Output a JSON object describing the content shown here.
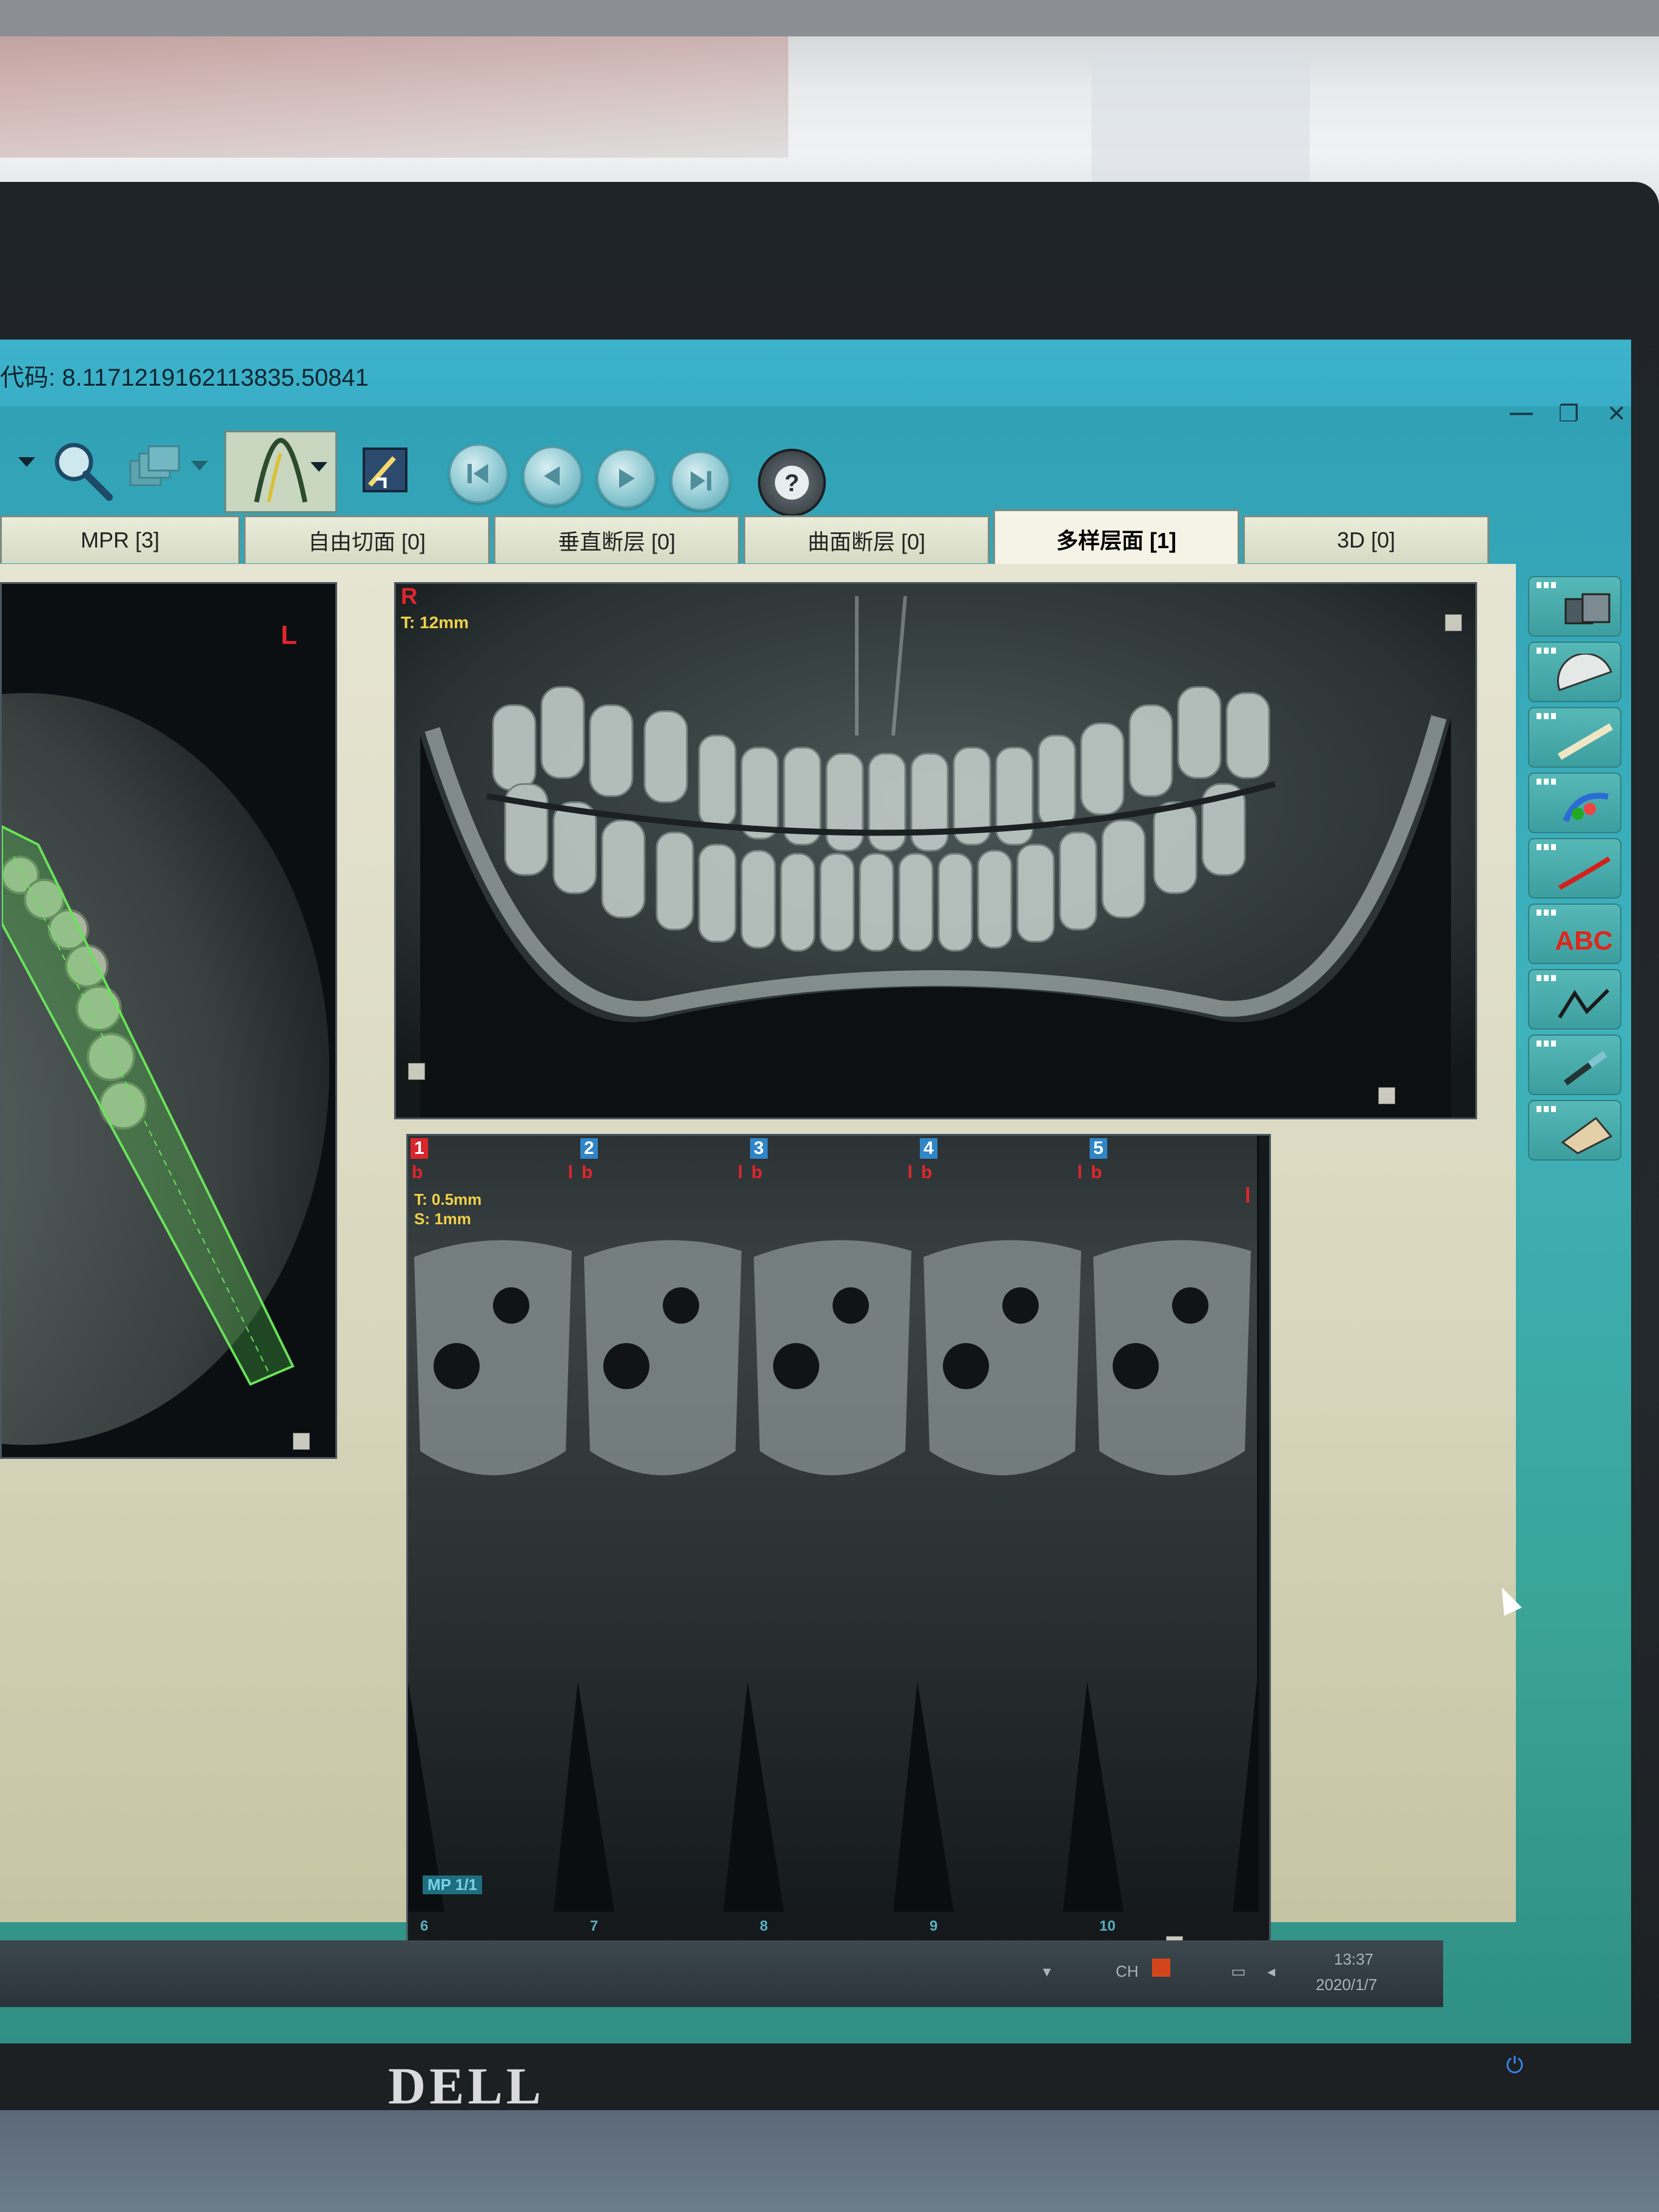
{
  "window": {
    "title": "代码: 8.1171219162113835.50841",
    "controls": [
      "minimize",
      "restore",
      "close"
    ]
  },
  "toolbar": {
    "tools": [
      "dropdown-arrow-icon",
      "magnifier-icon",
      "layers-icon",
      "curve-tool-icon",
      "export-icon"
    ],
    "nav": [
      "first-icon",
      "prev-icon",
      "next-icon",
      "last-icon"
    ],
    "help": "help-icon"
  },
  "tabs": [
    {
      "label": "MPR [3]",
      "active": false
    },
    {
      "label": "自由切面 [0]",
      "active": false
    },
    {
      "label": "垂直断层 [0]",
      "active": false
    },
    {
      "label": "曲面断层 [0]",
      "active": false
    },
    {
      "label": "多样层面 [1]",
      "active": true
    },
    {
      "label": "3D [0]",
      "active": false
    }
  ],
  "axial_view": {
    "orientation": "L"
  },
  "pano_view": {
    "orientation": "R",
    "thickness": "T: 12mm"
  },
  "cross_sections": {
    "thickness": "T: 0.5mm",
    "spacing": "S: 1mm",
    "panels": [
      {
        "num": "1",
        "left": "b",
        "right": "l",
        "active": true
      },
      {
        "num": "2",
        "left": "b",
        "right": "l",
        "active": false
      },
      {
        "num": "3",
        "left": "b",
        "right": "l",
        "active": false
      },
      {
        "num": "4",
        "left": "b",
        "right": "l",
        "active": false
      },
      {
        "num": "5",
        "left": "b",
        "right": "",
        "active": false
      }
    ],
    "page_label": "MP 1/1",
    "lower_row": [
      {
        "num": "6"
      },
      {
        "num": "7"
      },
      {
        "num": "8"
      },
      {
        "num": "9"
      },
      {
        "num": "10"
      }
    ],
    "right_mark": "l"
  },
  "tool_panel": {
    "tools": [
      "layout-icon",
      "protractor-icon",
      "ruler-icon",
      "paint-icon",
      "curve-icon",
      "text-abc-icon",
      "polyline-icon",
      "pen-icon",
      "calculator-icon"
    ],
    "text_tool_label": "ABC"
  },
  "taskbar": {
    "time": "13:37",
    "date": "2020/1/7"
  },
  "monitor": {
    "brand": "DELL"
  }
}
